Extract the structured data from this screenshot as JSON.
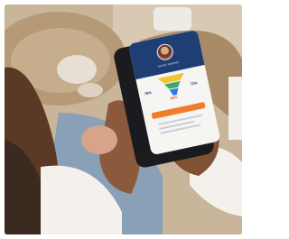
{
  "image": {
    "description_tags": [
      "photo-of-person-holding-smartphone",
      "app-profile-screen"
    ]
  },
  "phone": {
    "screen": {
      "profile_name": "Sarah Johnson",
      "stats": {
        "left": "78%",
        "right": "72%",
        "center": "68%"
      }
    }
  },
  "colors": {
    "header_blue": "#1f3f74",
    "accent_orange": "#ef7d2c",
    "funnel_yellow": "#f2c335",
    "funnel_green": "#3cab6a",
    "funnel_blue": "#2c7be5"
  }
}
